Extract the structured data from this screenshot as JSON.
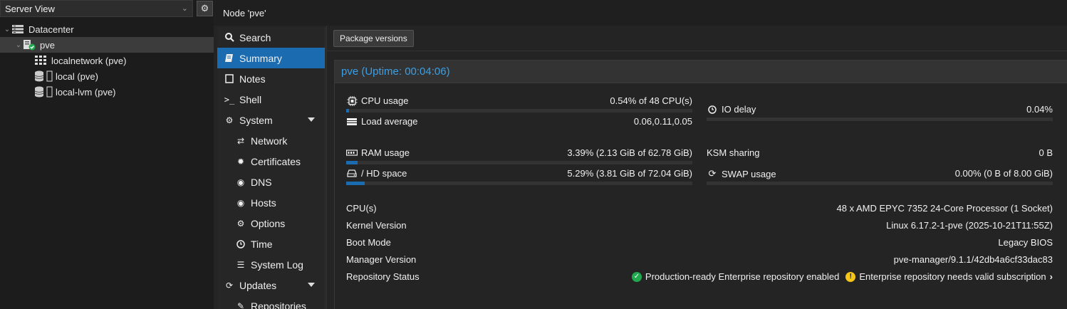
{
  "server_view": {
    "label": "Server View"
  },
  "tree": {
    "datacenter": "Datacenter",
    "node": "pve",
    "items": [
      {
        "label": "localnetwork (pve)",
        "icon": "grid-icon"
      },
      {
        "label": "local (pve)",
        "icon": "storage-icon"
      },
      {
        "label": "local-lvm (pve)",
        "icon": "storage-icon"
      }
    ]
  },
  "header": {
    "title": "Node 'pve'"
  },
  "nav": {
    "search": "Search",
    "summary": "Summary",
    "notes": "Notes",
    "shell": "Shell",
    "system": "System",
    "network": "Network",
    "certificates": "Certificates",
    "dns": "DNS",
    "hosts": "Hosts",
    "options": "Options",
    "time": "Time",
    "syslog": "System Log",
    "updates": "Updates",
    "repositories": "Repositories"
  },
  "toolbar": {
    "package_versions": "Package versions"
  },
  "summary": {
    "title": "pve (Uptime: 00:04:06)",
    "cpu": {
      "label": "CPU usage",
      "value": "0.54% of 48 CPU(s)",
      "fraction": 0.0054
    },
    "io_delay": {
      "label": "IO delay",
      "value": "0.04%",
      "fraction": 0.0004
    },
    "load": {
      "label": "Load average",
      "value": "0.06,0.11,0.05"
    },
    "ram": {
      "label": "RAM usage",
      "value": "3.39% (2.13 GiB of 62.78 GiB)",
      "fraction": 0.0339
    },
    "ksm": {
      "label": "KSM sharing",
      "value": "0 B"
    },
    "hd": {
      "label": "/ HD space",
      "value": "5.29% (3.81 GiB of 72.04 GiB)",
      "fraction": 0.0529
    },
    "swap": {
      "label": "SWAP usage",
      "value": "0.00% (0 B of 8.00 GiB)",
      "fraction": 0.0
    },
    "info": {
      "cpus_key": "CPU(s)",
      "cpus_val": "48 x AMD EPYC 7352 24-Core Processor (1 Socket)",
      "kernel_key": "Kernel Version",
      "kernel_val": "Linux 6.17.2-1-pve (2025-10-21T11:55Z)",
      "boot_key": "Boot Mode",
      "boot_val": "Legacy BIOS",
      "manager_key": "Manager Version",
      "manager_val": "pve-manager/9.1.1/42db4a6cf33dac83",
      "repo_key": "Repository Status",
      "repo_ok": "Production-ready Enterprise repository enabled",
      "repo_warn": "Enterprise repository needs valid subscription"
    }
  },
  "colors": {
    "accent": "#1a6bb0",
    "title_blue": "#3a9fe6",
    "ok": "#21a94f",
    "warn": "#f5c518"
  }
}
